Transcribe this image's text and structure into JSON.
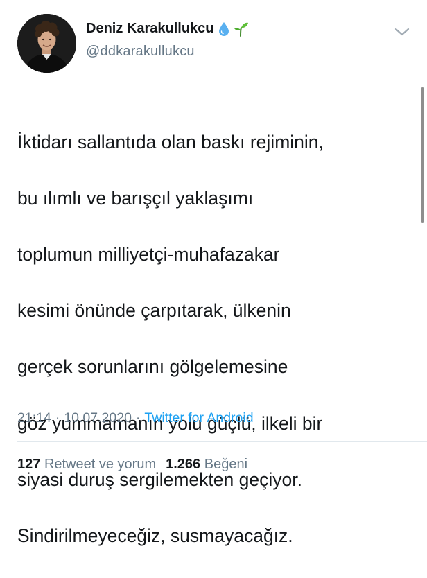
{
  "user": {
    "display_name": "Deniz Karakullukcu",
    "handle": "@ddkarakullukcu",
    "badges": [
      "droplet-icon",
      "seedling-icon"
    ]
  },
  "tweet": {
    "lines": [
      "İktidarı sallantıda olan baskı rejiminin,",
      "bu ılımlı ve barışçıl yaklaşımı",
      "toplumun milliyetçi-muhafazakar",
      "kesimi önünde çarpıtarak, ülkenin",
      "gerçek sorunlarını gölgelemesine",
      "göz yummamanın yolu güçlü, ilkeli bir",
      "siyasi duruş sergilemekten geçiyor.",
      "Sindirilmeyeceğiz, susmayacağız."
    ],
    "time": "21:14",
    "separator": "·",
    "date": "10.07.2020",
    "source": "Twitter for Android"
  },
  "stats": {
    "retweets_count": "127",
    "retweets_label": "Retweet ve yorum",
    "likes_count": "1.266",
    "likes_label": "Beğeni"
  },
  "colors": {
    "text": "#14171a",
    "secondary": "#657786",
    "link": "#1da1f2",
    "divider": "#e1e8ed"
  }
}
